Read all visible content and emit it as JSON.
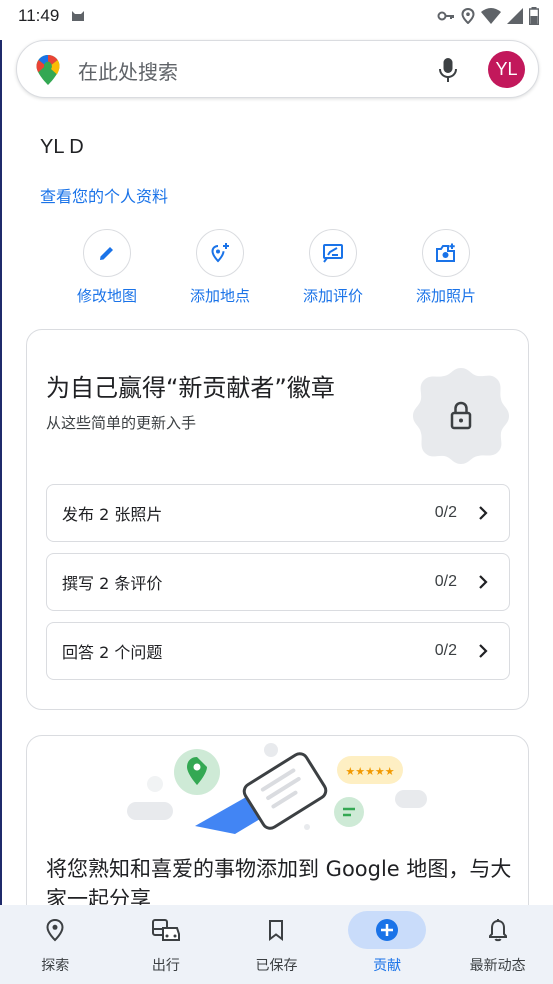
{
  "status_bar": {
    "time": "11:49"
  },
  "search": {
    "placeholder": "在此处搜索",
    "avatar_initials": "YL"
  },
  "profile": {
    "name": "YL D",
    "view_profile_link": "查看您的个人资料"
  },
  "actions": [
    {
      "label": "修改地图",
      "icon": "pencil-icon"
    },
    {
      "label": "添加地点",
      "icon": "add-place-icon"
    },
    {
      "label": "添加评价",
      "icon": "add-review-icon"
    },
    {
      "label": "添加照片",
      "icon": "add-photo-icon"
    }
  ],
  "badge_card": {
    "title": "为自己赢得“新贡献者”徽章",
    "subtitle": "从这些简单的更新入手",
    "tasks": [
      {
        "label": "发布 2 张照片",
        "progress": "0/2"
      },
      {
        "label": "撰写 2 条评价",
        "progress": "0/2"
      },
      {
        "label": "回答 2 个问题",
        "progress": "0/2"
      }
    ]
  },
  "promo_card": {
    "text": "将您熟知和喜爱的事物添加到 Google 地图，与大家一起分享"
  },
  "bottom_nav": [
    {
      "label": "探索",
      "icon": "location-pin-icon",
      "active": false
    },
    {
      "label": "出行",
      "icon": "commute-icon",
      "active": false
    },
    {
      "label": "已保存",
      "icon": "bookmark-icon",
      "active": false
    },
    {
      "label": "贡献",
      "icon": "add-circle-icon",
      "active": true
    },
    {
      "label": "最新动态",
      "icon": "bell-icon",
      "active": false
    }
  ],
  "colors": {
    "accent": "#1a73e8",
    "avatar": "#c2185b",
    "nav_bg": "#eef2f8",
    "nav_active_pill": "#c9dcfa"
  }
}
